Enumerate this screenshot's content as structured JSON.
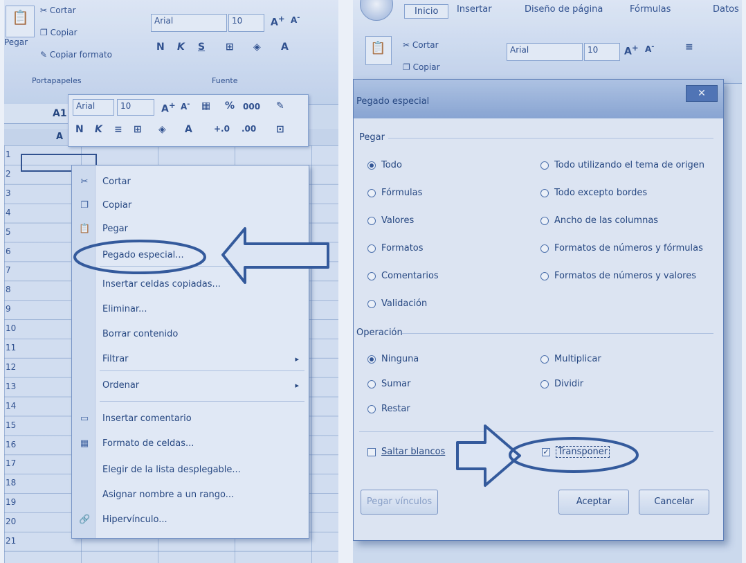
{
  "left": {
    "ribbon": {
      "paste": "Pegar",
      "cut": "Cortar",
      "copy": "Copiar",
      "format_painter": "Copiar formato",
      "group_clipboard": "Portapapeles",
      "group_font": "Fuente",
      "font_name": "Arial",
      "font_size": "10"
    },
    "name_box": "A1",
    "column_header": "A",
    "mini_toolbar": {
      "font_name": "Arial",
      "font_size": "10",
      "percent": "%",
      "thousands": "000"
    },
    "row_numbers": [
      "1",
      "2",
      "3",
      "4",
      "5",
      "6",
      "7",
      "8",
      "9",
      "10",
      "11",
      "12",
      "13",
      "14",
      "15",
      "16",
      "17",
      "18",
      "19",
      "20",
      "21"
    ],
    "context_menu": {
      "items": [
        {
          "label": "Cortar",
          "icon": "scissors-icon"
        },
        {
          "label": "Copiar",
          "icon": "copy-icon"
        },
        {
          "label": "Pegar",
          "icon": "paste-icon"
        },
        {
          "label": "Pegado especial..."
        },
        {
          "label": "Insertar celdas copiadas..."
        },
        {
          "label": "Eliminar..."
        },
        {
          "label": "Borrar contenido"
        },
        {
          "label": "Filtrar"
        },
        {
          "label": "Ordenar"
        },
        {
          "label": "Insertar comentario",
          "icon": "comment-icon"
        },
        {
          "label": "Formato de celdas...",
          "icon": "format-cells-icon"
        },
        {
          "label": "Elegir de la lista desplegable..."
        },
        {
          "label": "Asignar nombre a un rango..."
        },
        {
          "label": "Hipervínculo...",
          "icon": "hyperlink-icon"
        }
      ]
    }
  },
  "right": {
    "ribbon": {
      "tabs": [
        "Inicio",
        "Insertar",
        "Diseño de página",
        "Fórmulas",
        "Datos"
      ],
      "cut": "Cortar",
      "copy": "Copiar",
      "font_name": "Arial",
      "font_size": "10"
    },
    "dialog": {
      "title": "Pegado especial",
      "paste_section": "Pegar",
      "paste_options_left": [
        "Todo",
        "Fórmulas",
        "Valores",
        "Formatos",
        "Comentarios",
        "Validación"
      ],
      "paste_options_right": [
        "Todo utilizando el tema de origen",
        "Todo excepto bordes",
        "Ancho de las columnas",
        "Formatos de números y fórmulas",
        "Formatos de números y valores"
      ],
      "operation_section": "Operación",
      "operation_options_left": [
        "Ninguna",
        "Sumar",
        "Restar"
      ],
      "operation_options_right": [
        "Multiplicar",
        "Dividir"
      ],
      "skip_blanks": "Saltar blancos",
      "transpose": "Transponer",
      "paste_link": "Pegar vínculos",
      "ok": "Aceptar",
      "cancel": "Cancelar"
    }
  },
  "colors": {
    "tint": "#dbe5f3",
    "accent": "#2d4f8f",
    "highlight_stroke": "#2f5597"
  }
}
